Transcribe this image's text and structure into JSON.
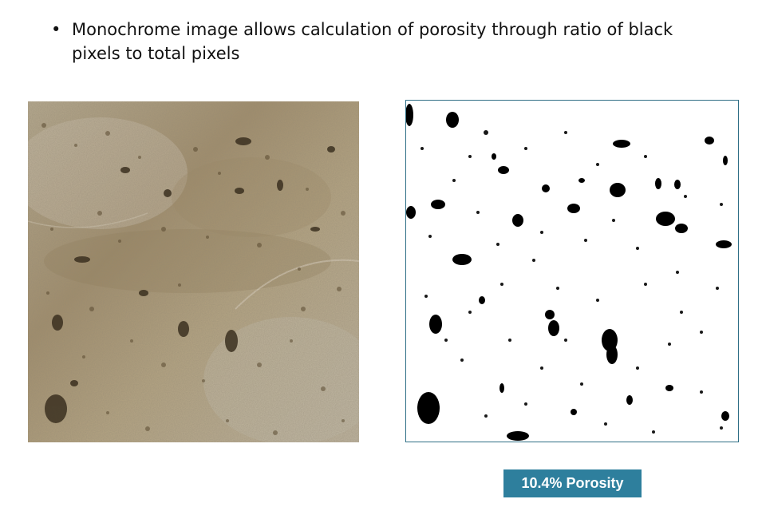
{
  "slide": {
    "bullet_marker": "•",
    "bullet_text": "Monochrome image allows calculation of porosity through ratio of black pixels to total pixels",
    "porosity_label": "10.4% Porosity",
    "colors": {
      "label_background": "#2e7f9d",
      "image_border": "#2f6f86",
      "stone_base": "#b8a88a",
      "pores": "#000000"
    }
  },
  "images": {
    "left": "stone-surface-photo",
    "right": "monochrome-threshold-image"
  }
}
